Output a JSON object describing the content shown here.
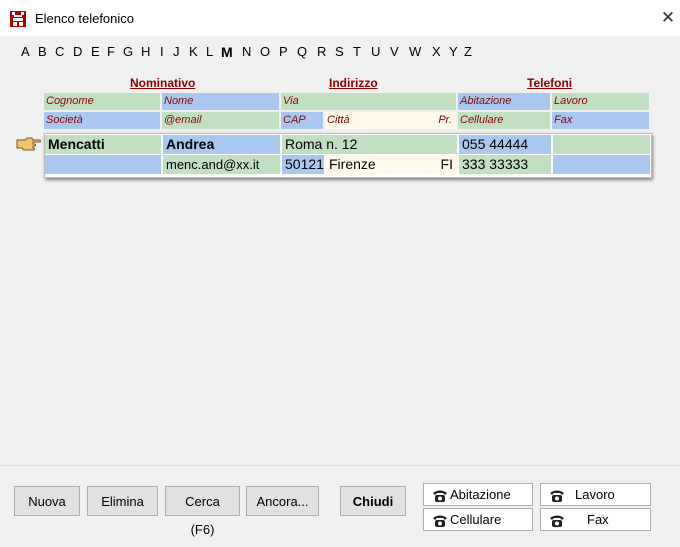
{
  "window": {
    "title": "Elenco telefonico",
    "close_glyph": "✕"
  },
  "alphabet": {
    "letters": [
      "A",
      "B",
      "C",
      "D",
      "E",
      "F",
      "G",
      "H",
      "I",
      "J",
      "K",
      "L",
      "M",
      "N",
      "O",
      "P",
      "Q",
      "R",
      "S",
      "T",
      "U",
      "V",
      "W",
      "X",
      "Y",
      "Z"
    ],
    "active": "M"
  },
  "headers": {
    "nominativo": "Nominativo",
    "indirizzo": "Indirizzo",
    "telefoni": "Telefoni"
  },
  "fields": {
    "cognome": "Cognome",
    "nome": "Nome",
    "via": "Via",
    "abitazione": "Abitazione",
    "lavoro": "Lavoro",
    "societa": "Società",
    "email": "@email",
    "cap": "CAP",
    "citta": "Città",
    "pr": "Pr.",
    "cellulare": "Cellulare",
    "fax": "Fax"
  },
  "record": {
    "cognome": "Mencatti",
    "nome": "Andrea",
    "via": "Roma n. 12",
    "abitazione": "055 44444",
    "lavoro": "",
    "societa": "",
    "email": "menc.and@xx.it",
    "cap": "50121",
    "citta": "Firenze",
    "pr": "FI",
    "cellulare": "333 33333",
    "fax": ""
  },
  "buttons": {
    "nuova": "Nuova",
    "elimina": "Elimina",
    "cerca": "Cerca (F6)",
    "ancora": "Ancora...",
    "chiudi": "Chiudi"
  },
  "phone_buttons": {
    "abitazione": "Abitazione",
    "lavoro": "Lavoro",
    "cellulare": "Cellulare",
    "fax": "Fax"
  },
  "colors": {
    "header_red": "#8b0000",
    "row_green": "#c1e0c1",
    "row_blue": "#a9c8f0",
    "cream": "#fffaea"
  }
}
